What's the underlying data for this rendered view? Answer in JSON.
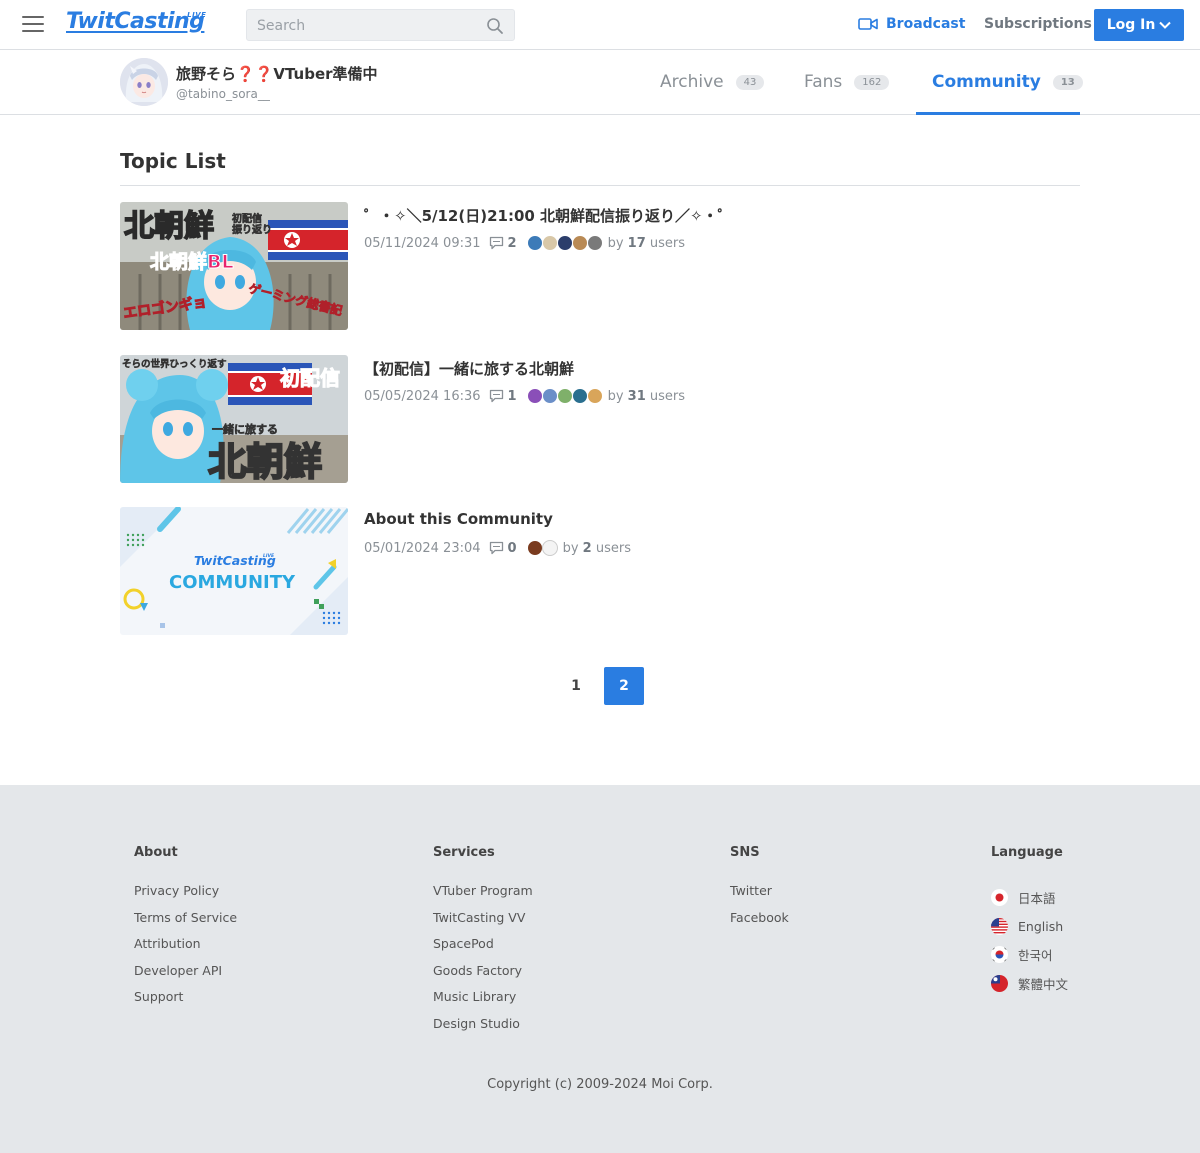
{
  "header": {
    "logo": "TwitCasting",
    "logo_badge": "LIVE",
    "search_placeholder": "Search",
    "broadcast_label": "Broadcast",
    "subscriptions_label": "Subscriptions",
    "login_label": "Log In"
  },
  "profile": {
    "name": "旅野そら❓❓VTuber準備中",
    "handle": "@tabino_sora__",
    "tabs": [
      {
        "label": "Archive",
        "count": "43",
        "active": false
      },
      {
        "label": "Fans",
        "count": "162",
        "active": false
      },
      {
        "label": "Community",
        "count": "13",
        "active": true
      }
    ]
  },
  "main": {
    "section_title": "Topic List",
    "topics": [
      {
        "title": "゜・✧＼5/12(日)21:00 北朝鮮配信振り返り／✧・゜",
        "date": "05/11/2024 09:31",
        "comments": "2",
        "by_prefix": "by",
        "users_count": "17",
        "users_suffix": "users",
        "thumb_texts": [
          "北朝鮮",
          "初配信",
          "振り返り",
          "北朝鮮BL",
          "エロゴンギョ",
          "ゲーミング総書記"
        ]
      },
      {
        "title": "【初配信】一緒に旅する北朝鮮",
        "date": "05/05/2024 16:36",
        "comments": "1",
        "by_prefix": "by",
        "users_count": "31",
        "users_suffix": "users",
        "thumb_texts": [
          "そらの世界ひっくり返す",
          "初配信",
          "一緒に旅する",
          "北朝鮮"
        ]
      },
      {
        "title": "About this Community",
        "date": "05/01/2024 23:04",
        "comments": "0",
        "by_prefix": "by",
        "users_count": "2",
        "users_suffix": "users",
        "thumb_texts": [
          "TwitCasting",
          "LIVE",
          "COMMUNITY"
        ]
      }
    ],
    "pagination": [
      "1",
      "2"
    ],
    "current_page": "2"
  },
  "footer": {
    "about": {
      "heading": "About",
      "links": [
        "Privacy Policy",
        "Terms of Service",
        "Attribution",
        "Developer API",
        "Support"
      ]
    },
    "services": {
      "heading": "Services",
      "links": [
        "VTuber Program",
        "TwitCasting VV",
        "SpacePod",
        "Goods Factory",
        "Music Library",
        "Design Studio"
      ]
    },
    "sns": {
      "heading": "SNS",
      "links": [
        "Twitter",
        "Facebook"
      ]
    },
    "language": {
      "heading": "Language",
      "items": [
        "日本語",
        "English",
        "한국어",
        "繁體中文"
      ]
    },
    "copyright": "Copyright (c) 2009-2024 Moi Corp."
  },
  "colors": {
    "accent": "#2a7de1",
    "footer_bg": "#e4e7ea",
    "muted": "#8a9096"
  }
}
